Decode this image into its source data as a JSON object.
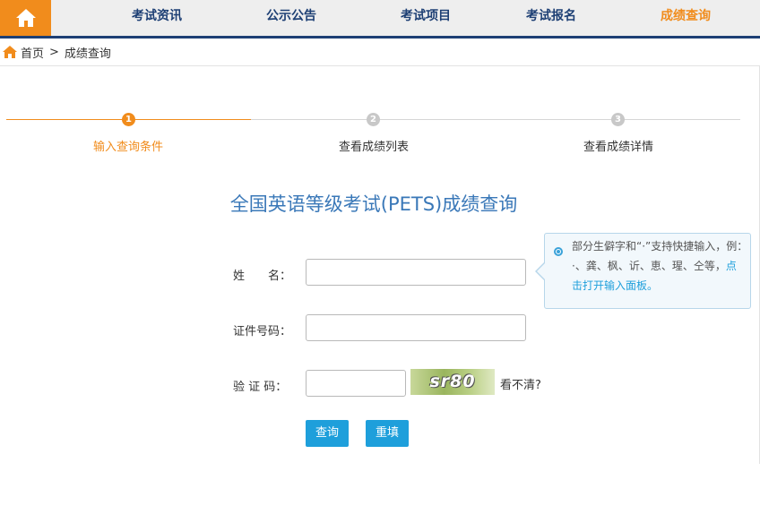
{
  "nav": {
    "items": [
      {
        "label": "考试资讯"
      },
      {
        "label": "公示公告"
      },
      {
        "label": "考试项目"
      },
      {
        "label": "考试报名"
      },
      {
        "label": "成绩查询"
      }
    ],
    "active": "成绩查询",
    "accent_color": "#f18c1c",
    "brand_color": "#1d3f74"
  },
  "breadcrumb": {
    "home": "首页",
    "separator": ">",
    "current": "成绩查询"
  },
  "steps": [
    {
      "num": "1",
      "label": "输入查询条件",
      "active": true
    },
    {
      "num": "2",
      "label": "查看成绩列表",
      "active": false
    },
    {
      "num": "3",
      "label": "查看成绩详情",
      "active": false
    }
  ],
  "form": {
    "title": "全国英语等级考试(PETS)成绩查询",
    "name_label": "姓　　名：",
    "name_value": "",
    "id_label": "证件号码：",
    "id_value": "",
    "captcha_label": "验 证 码：",
    "captcha_value": "",
    "captcha_image_text": "sr80",
    "refresh_label": "看不清?",
    "submit_label": "查询",
    "reset_label": "重填"
  },
  "tip": {
    "text": "部分生僻字和“·”支持快捷输入，例：·、龚、枫、䜣、恵、瑆、仝等，",
    "link": "点击打开输入面板。"
  }
}
